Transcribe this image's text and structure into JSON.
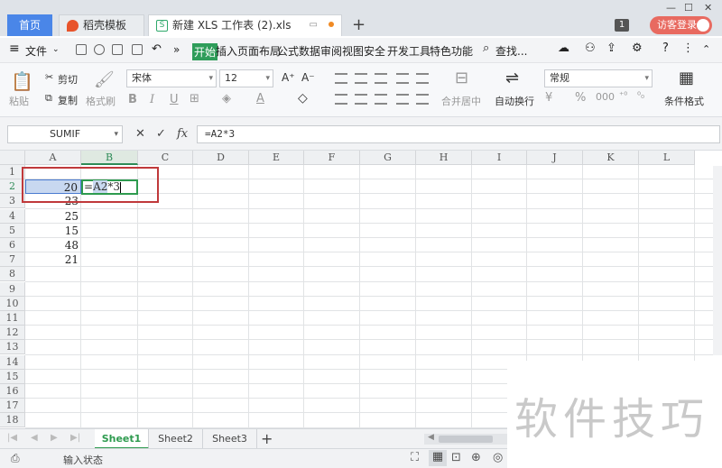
{
  "tabs": {
    "home": "首页",
    "tab1": "稻壳模板",
    "tab2": "新建 XLS 工作表 (2).xls",
    "badge": "1",
    "login": "访客登录"
  },
  "menu": {
    "file": "文件",
    "items": [
      "开始",
      "插入",
      "页面布局",
      "公式",
      "数据",
      "审阅",
      "视图",
      "安全",
      "开发工具",
      "特色功能"
    ],
    "search": "查找..."
  },
  "ribbon": {
    "cut": "剪切",
    "paste": "粘贴",
    "copy": "复制",
    "format_painter": "格式刷",
    "font": "宋体",
    "size": "12",
    "merge": "合并居中",
    "wrap": "自动换行",
    "number_format": "常规",
    "cond_format": "条件格式"
  },
  "formula_bar": {
    "name_box": "SUMIF",
    "formula": "=A2*3"
  },
  "grid": {
    "columns": [
      "A",
      "B",
      "C",
      "D",
      "E",
      "F",
      "G",
      "H",
      "I",
      "J",
      "K",
      "L"
    ],
    "rows": [
      "1",
      "2",
      "3",
      "4",
      "5",
      "6",
      "7",
      "8",
      "9",
      "10",
      "11",
      "12",
      "13",
      "14",
      "15",
      "16",
      "17",
      "18"
    ],
    "colA_values": [
      "",
      "20",
      "23",
      "25",
      "15",
      "48",
      "21"
    ],
    "edit_prefix": "=",
    "edit_ref": "A2",
    "edit_suffix": "*3"
  },
  "sheets": [
    "Sheet1",
    "Sheet2",
    "Sheet3"
  ],
  "status": {
    "mode": "输入状态"
  },
  "watermark": "软件技巧"
}
